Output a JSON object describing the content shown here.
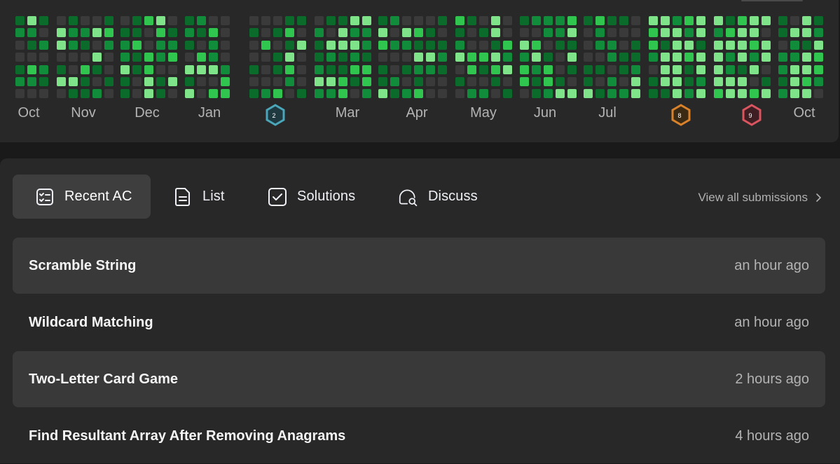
{
  "colors": {
    "empty": "#3a3a3a",
    "level1": "#0b6b2b",
    "level2": "#118c3a",
    "level3": "#2fc54f",
    "level4": "#7ee389"
  },
  "heatmap": {
    "months": [
      "Oct",
      "Nov",
      "Dec",
      "Jan",
      "Mar",
      "Apr",
      "May",
      "Jun",
      "Jul",
      "Oct"
    ],
    "badges": [
      {
        "name": "badge-2",
        "text": "2",
        "color": "#4aa6b8"
      },
      {
        "name": "badge-8",
        "text": "8",
        "color": "#d9822b"
      },
      {
        "name": "badge-9",
        "text": "9",
        "color": "#d9555f"
      }
    ]
  },
  "tabs": [
    {
      "label": "Recent AC",
      "icon": "checklist-icon",
      "active": true
    },
    {
      "label": "List",
      "icon": "document-icon",
      "active": false
    },
    {
      "label": "Solutions",
      "icon": "checkbox-icon",
      "active": false
    },
    {
      "label": "Discuss",
      "icon": "chat-search-icon",
      "active": false
    }
  ],
  "view_all": {
    "label": "View all submissions",
    "icon": "chevron-right-icon"
  },
  "submissions": [
    {
      "title": "Scramble String",
      "time": "an hour ago"
    },
    {
      "title": "Wildcard Matching",
      "time": "an hour ago"
    },
    {
      "title": "Two-Letter Card Game",
      "time": "2 hours ago"
    },
    {
      "title": "Find Resultant Array After Removing Anagrams",
      "time": "4 hours ago"
    }
  ]
}
